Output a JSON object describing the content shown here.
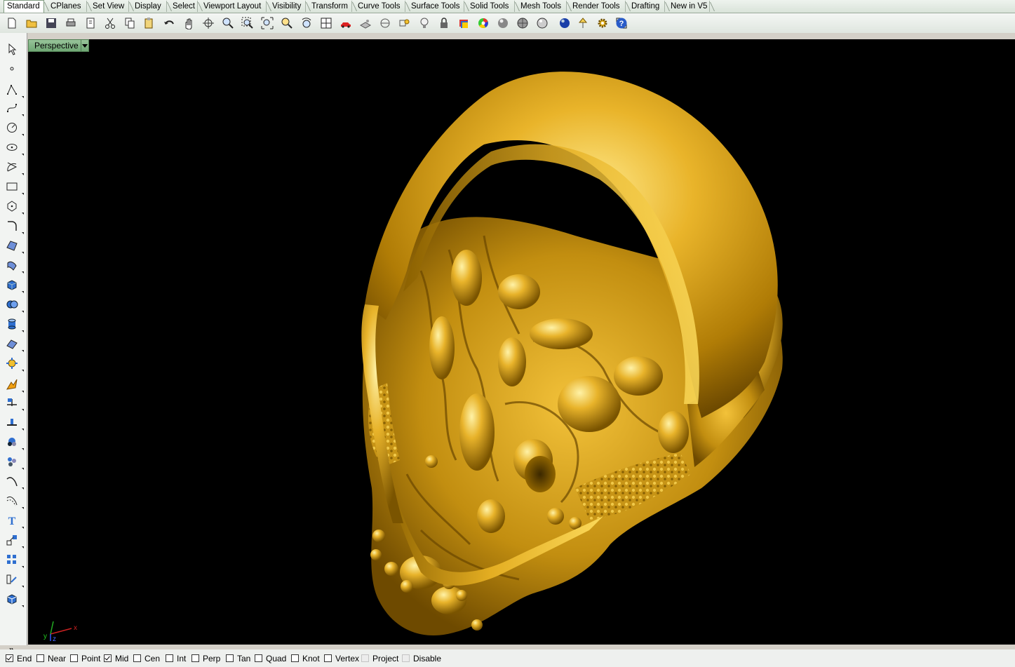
{
  "tabs": [
    "Standard",
    "CPlanes",
    "Set View",
    "Display",
    "Select",
    "Viewport Layout",
    "Visibility",
    "Transform",
    "Curve Tools",
    "Surface Tools",
    "Solid Tools",
    "Mesh Tools",
    "Render Tools",
    "Drafting",
    "New in V5"
  ],
  "active_tab": "Standard",
  "toolbar_icons": [
    "new-file-icon",
    "open-folder-icon",
    "save-icon",
    "print-icon",
    "import-icon",
    "cut-icon",
    "copy-icon",
    "paste-icon",
    "undo-icon",
    "pan-hand-icon",
    "rotate-view-icon",
    "zoom-icon",
    "zoom-window-icon",
    "zoom-extents-icon",
    "zoom-selected-icon",
    "undo-view-icon",
    "four-viewports-icon",
    "car-render-icon",
    "cplane-icon",
    "distance-icon",
    "osnap-icon",
    "light-icon",
    "lock-icon",
    "layer-icon",
    "color-wheel-icon",
    "rendered-sphere-icon",
    "shaded-sphere-icon",
    "ghosted-sphere-icon",
    "blue-sphere-icon",
    "lamp-icon",
    "options-gear-icon",
    "snap-grid-icon",
    "help-icon"
  ],
  "left_tools": [
    "select-arrow-icon",
    "point-icon",
    "polyline-icon",
    "curve-icon",
    "circle-icon",
    "ellipse-icon",
    "arc-icon",
    "rectangle-icon",
    "polygon-icon",
    "fillet-curve-icon",
    "surface-icon",
    "surface-edit-icon",
    "box-icon",
    "boolean-icon",
    "cylinder-icon",
    "plane-icon",
    "solid-tools-icon",
    "explode-icon",
    "trim-icon",
    "join-icon",
    "point-cloud-icon",
    "group-icon",
    "curve-from-object-icon",
    "offset-curve-icon",
    "text-icon",
    "move-icon",
    "array-icon",
    "dimension-icon",
    "block-icon"
  ],
  "more_label": "»",
  "viewport": {
    "label": "Perspective"
  },
  "axes": {
    "x": "x",
    "y": "y",
    "z": "z"
  },
  "osnaps": [
    {
      "label": "End",
      "checked": true,
      "enabled": true
    },
    {
      "label": "Near",
      "checked": false,
      "enabled": true
    },
    {
      "label": "Point",
      "checked": false,
      "enabled": true
    },
    {
      "label": "Mid",
      "checked": true,
      "enabled": true
    },
    {
      "label": "Cen",
      "checked": false,
      "enabled": true
    },
    {
      "label": "Int",
      "checked": false,
      "enabled": true
    },
    {
      "label": "Perp",
      "checked": false,
      "enabled": true
    },
    {
      "label": "Tan",
      "checked": false,
      "enabled": true
    },
    {
      "label": "Quad",
      "checked": false,
      "enabled": true
    },
    {
      "label": "Knot",
      "checked": false,
      "enabled": true
    },
    {
      "label": "Vertex",
      "checked": false,
      "enabled": true
    },
    {
      "label": "Project",
      "checked": false,
      "enabled": false
    },
    {
      "label": "Disable",
      "checked": false,
      "enabled": false
    }
  ],
  "colors": {
    "gold": "#d8a41a",
    "gold_light": "#f6d65a",
    "gold_dark": "#7a5400",
    "viewport_bg": "#000000",
    "tab_green": "#7fb47f"
  }
}
